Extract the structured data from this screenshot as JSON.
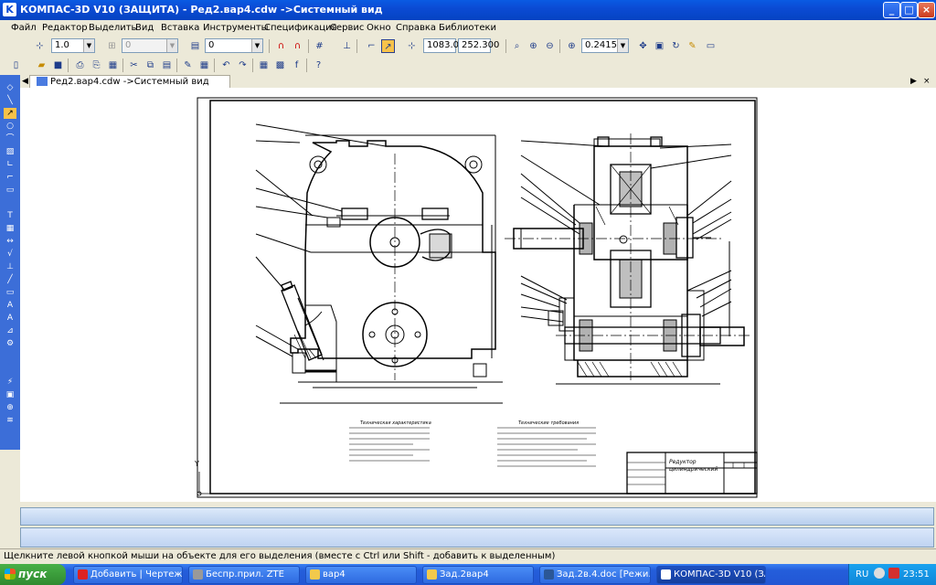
{
  "window": {
    "title": "КОМПАС-3D V10 (ЗАЩИТА) - Ред2.вар4.cdw ->Системный вид",
    "minimize": "_",
    "maximize": "□",
    "close": "×"
  },
  "menu": [
    "Файл",
    "Редактор",
    "Выделить",
    "Вид",
    "Вставка",
    "Инструменты",
    "Спецификация",
    "Сервис",
    "Окно",
    "Справка",
    "Библиотеки"
  ],
  "toolbar1": {
    "line_width": "1.0",
    "style_value": "0",
    "layer_value": "0",
    "coord_x": "1083.03",
    "coord_y": "252.300",
    "zoom_value": "0.2415"
  },
  "document_tab": {
    "label": "Ред2.вар4.cdw ->Системный вид"
  },
  "drawing": {
    "title_block_line1": "Редуктор",
    "title_block_line2": "цилиндрический",
    "notes_left_title": "Техническая характеристика",
    "notes_right_title": "Технические требования",
    "axis_y": "Y"
  },
  "status": "Щелкните левой кнопкой мыши на объекте для его выделения (вместе с Ctrl или Shift - добавить к выделенным)",
  "taskbar": {
    "start": "пуск",
    "tasks": [
      "Добавить | Чертеж...",
      "Беспр.прил. ZTE",
      "вар4",
      "Зад.2вар4",
      "Зад.2в.4.doc [Режи...",
      "КОМПАС-3D V10 (ЗА..."
    ],
    "lang": "RU",
    "clock": "23:51"
  },
  "colors": {
    "titlebar": "#0b4bd4",
    "taskbar": "#245edb",
    "panel": "#ece9d8"
  }
}
